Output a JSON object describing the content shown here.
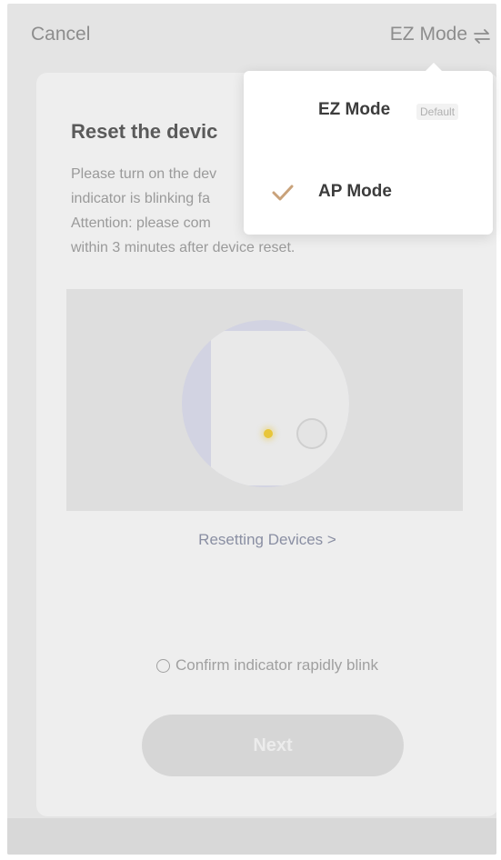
{
  "header": {
    "cancel_label": "Cancel",
    "mode_label": "EZ Mode",
    "mode_icon": "swap-arrows-icon"
  },
  "main": {
    "title": "Reset the devic",
    "description_lines": [
      "Please turn on the dev",
      "indicator is blinking fa",
      "Attention: please com",
      "within 3 minutes after device reset."
    ],
    "resetting_link": "Resetting Devices >",
    "confirm_label": "Confirm indicator rapidly blink",
    "next_label": "Next"
  },
  "mode_menu": {
    "items": [
      {
        "label": "EZ Mode",
        "badge": "Default",
        "selected": false
      },
      {
        "label": "AP Mode",
        "badge": "",
        "selected": true
      }
    ],
    "check_color": "#c9a27a"
  },
  "colors": {
    "accent": "#c9a27a",
    "indicator_dot": "#e8c63a"
  }
}
